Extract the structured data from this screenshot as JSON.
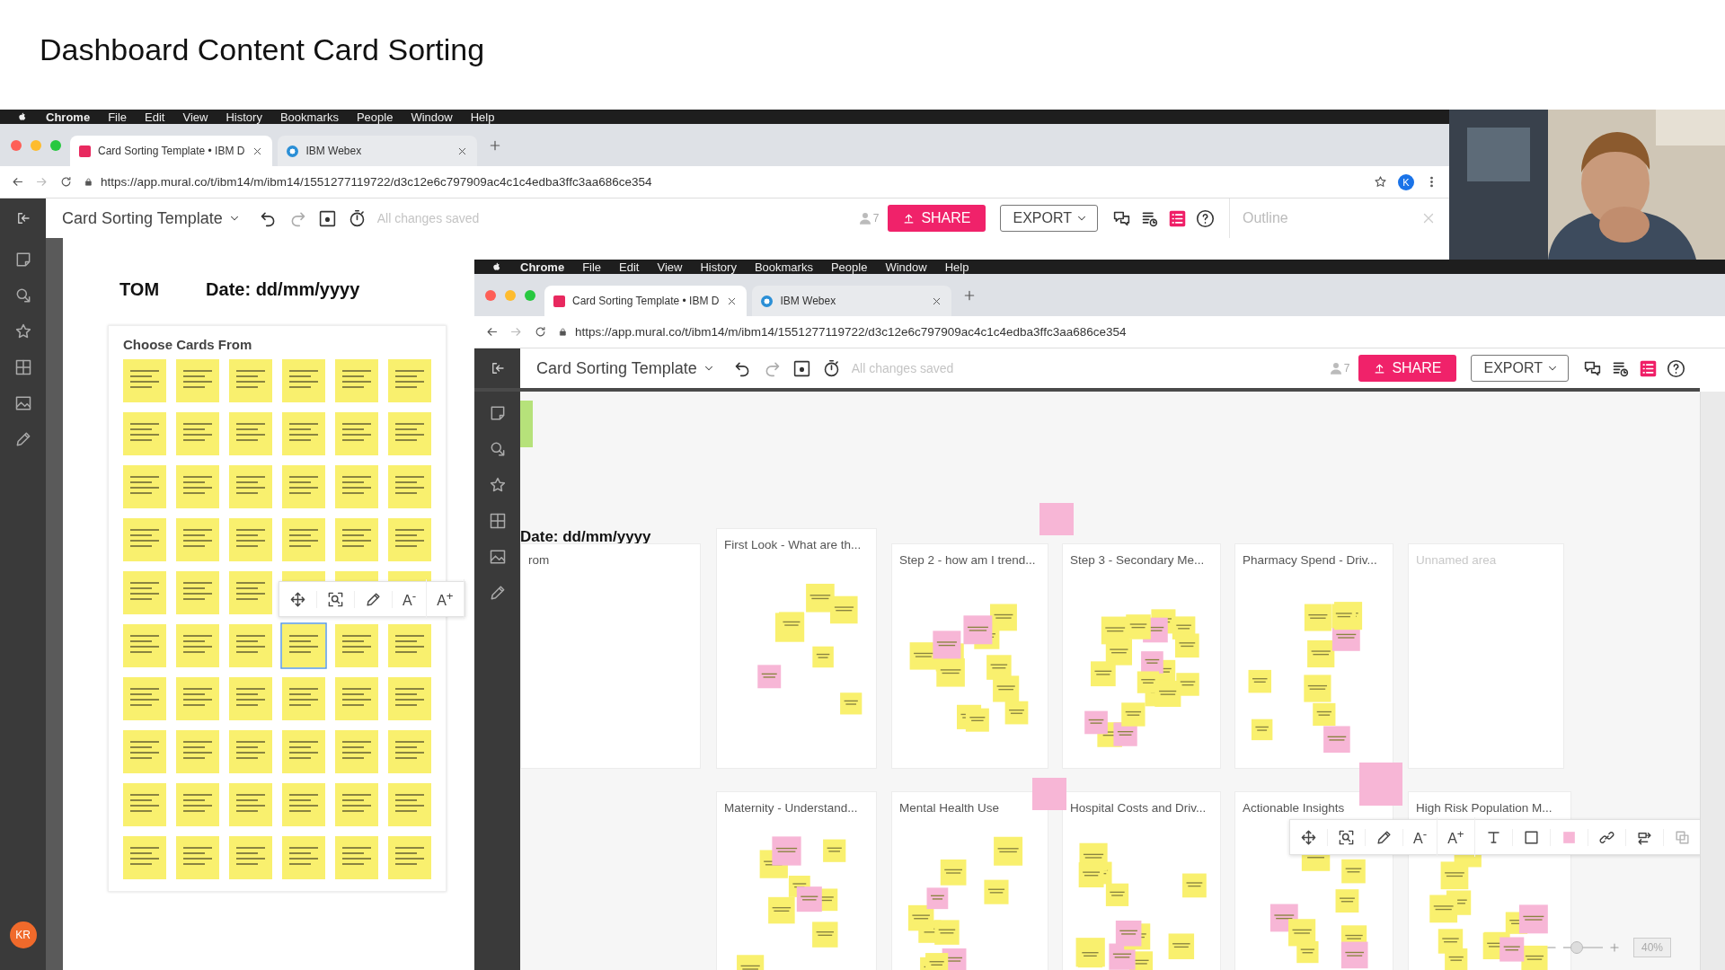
{
  "page_title": "Dashboard Content Card Sorting",
  "outer_window": {
    "menu_bar": {
      "app": "Chrome",
      "items": [
        "File",
        "Edit",
        "View",
        "History",
        "Bookmarks",
        "People",
        "Window",
        "Help"
      ]
    },
    "tabs": [
      {
        "label": "Card Sorting Template • IBM D",
        "selected": true
      },
      {
        "label": "IBM Webex",
        "selected": false
      }
    ],
    "address": "https://app.mural.co/t/ibm14/m/ibm14/1551277119722/d3c12e6c797909ac4c1c4edba3ffc3aa686ce354",
    "profile": "K",
    "toolbar": {
      "title": "Card Sorting Template",
      "status": "All changes saved",
      "collaborators": "7",
      "share": "SHARE",
      "export": "EXPORT"
    },
    "outline": {
      "title": "Outline"
    },
    "board": {
      "name": "TOM",
      "date": "Date: dd/mm/yyyy",
      "section_title": "Choose Cards From",
      "text_tools": [
        "A$^{-}$",
        "A$^{+}$"
      ]
    },
    "user_badge": "KR"
  },
  "inner_window": {
    "menu_bar": {
      "app": "Chrome",
      "items": [
        "File",
        "Edit",
        "View",
        "History",
        "Bookmarks",
        "People",
        "Window",
        "Help"
      ]
    },
    "tabs": [
      {
        "label": "Card Sorting Template • IBM D",
        "selected": true
      },
      {
        "label": "IBM Webex",
        "selected": false
      }
    ],
    "address": "https://app.mural.co/t/ibm14/m/ibm14/1551277119722/d3c12e6c797909ac4c1c4edba3ffc3aa686ce354",
    "toolbar": {
      "title": "Card Sorting Template",
      "status": "All changes saved",
      "collaborators": "7",
      "share": "SHARE",
      "export": "EXPORT"
    },
    "canvas": {
      "date": "Date: dd/mm/yyyy",
      "areas": [
        {
          "title": "rom",
          "unnamed": false
        },
        {
          "title": "First Look - What are th...",
          "unnamed": false
        },
        {
          "title": "Step 2 - how am I trend...",
          "unnamed": false
        },
        {
          "title": "Step 3 - Secondary Me...",
          "unnamed": false
        },
        {
          "title": "Pharmacy Spend - Driv...",
          "unnamed": false
        },
        {
          "title": "Unnamed area",
          "unnamed": true
        },
        {
          "title": "Maternity - Understand...",
          "unnamed": false
        },
        {
          "title": "Mental Health Use",
          "unnamed": false
        },
        {
          "title": "Hospital Costs and Driv...",
          "unnamed": false
        },
        {
          "title": "Actionable Insights",
          "unnamed": false
        },
        {
          "title": "High Risk Population M...",
          "unnamed": false
        }
      ],
      "text_tools": [
        "A$^{-}$",
        "A$^{+}$"
      ],
      "zoom_slider": {
        "level": 0.25
      },
      "zoom": "40%"
    }
  }
}
